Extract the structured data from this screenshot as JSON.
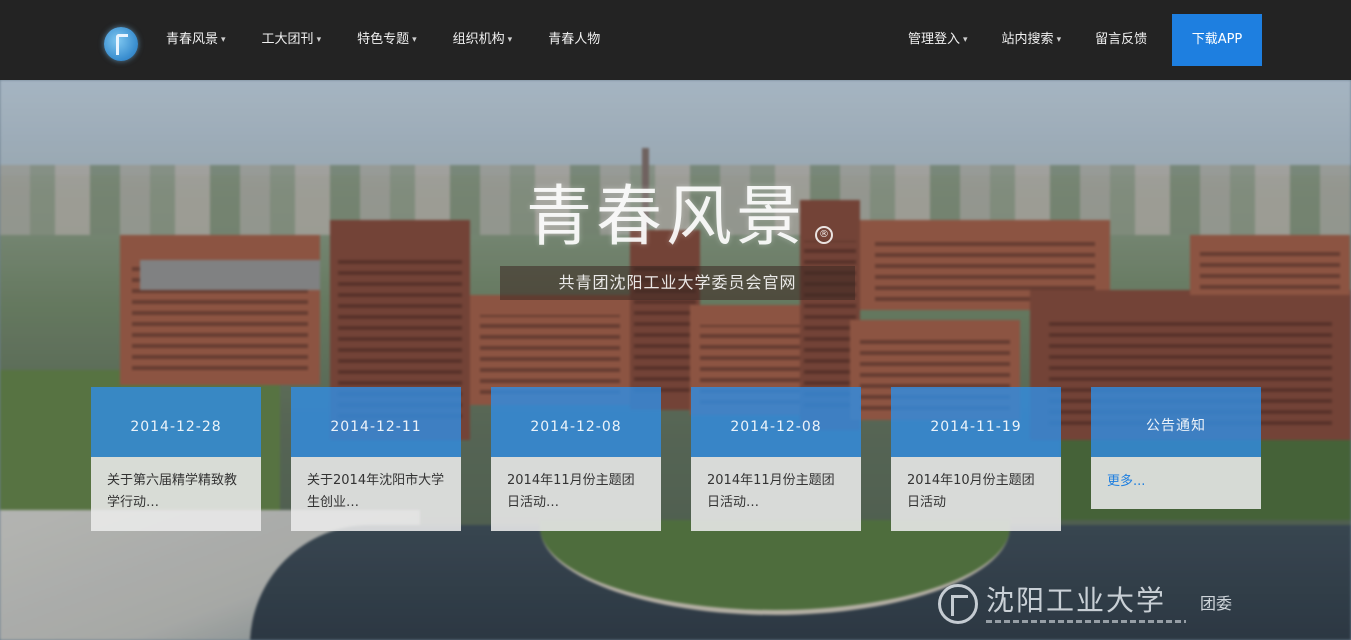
{
  "nav": {
    "left_items": [
      {
        "label": "青春风景",
        "has_dropdown": true
      },
      {
        "label": "工大团刊",
        "has_dropdown": true
      },
      {
        "label": "特色专题",
        "has_dropdown": true
      },
      {
        "label": "组织机构",
        "has_dropdown": true
      },
      {
        "label": "青春人物",
        "has_dropdown": false
      }
    ],
    "right_items": [
      {
        "label": "管理登入",
        "has_dropdown": true
      },
      {
        "label": "站内搜索",
        "has_dropdown": true
      },
      {
        "label": "留言反馈",
        "has_dropdown": false
      }
    ],
    "download_label": "下载APP",
    "caret_glyph": "▾"
  },
  "hero": {
    "title": "青春风景",
    "title_badge": "®",
    "subtitle": "共青团沈阳工业大学委员会官网"
  },
  "cards": [
    {
      "date": "2014-12-28",
      "text": "关于第六届精学精致教学行动…"
    },
    {
      "date": "2014-12-11",
      "text": "关于2014年沈阳市大学生创业…"
    },
    {
      "date": "2014-12-08",
      "text": "2014年11月份主题团日活动…"
    },
    {
      "date": "2014-12-08",
      "text": "2014年11月份主题团日活动…"
    },
    {
      "date": "2014-11-19",
      "text": "2014年10月份主题团日活动"
    }
  ],
  "notice_card": {
    "title": "公告通知",
    "link": "更多..."
  },
  "watermark": {
    "name": "沈阳工业大学",
    "suffix": "团委"
  },
  "colors": {
    "nav_bg": "#232323",
    "accent": "#1e7fe0",
    "card_header": "#328ce1"
  }
}
